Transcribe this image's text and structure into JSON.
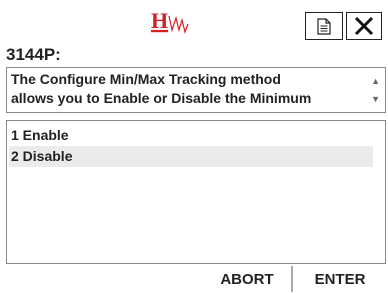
{
  "header": {
    "logo_icon": "hw-logo-icon",
    "brand_color": "#d42020",
    "doc_icon": "document-icon",
    "close_icon": "close-icon"
  },
  "device": {
    "title": "3144P:"
  },
  "description": {
    "lines": [
      "The Configure Min/Max Tracking method",
      "allows you to Enable or Disable the Minimum"
    ]
  },
  "options": {
    "items": [
      {
        "label": "1 Enable",
        "selected": false
      },
      {
        "label": "2 Disable",
        "selected": true
      }
    ]
  },
  "actions": {
    "abort_label": "ABORT",
    "enter_label": "ENTER"
  }
}
